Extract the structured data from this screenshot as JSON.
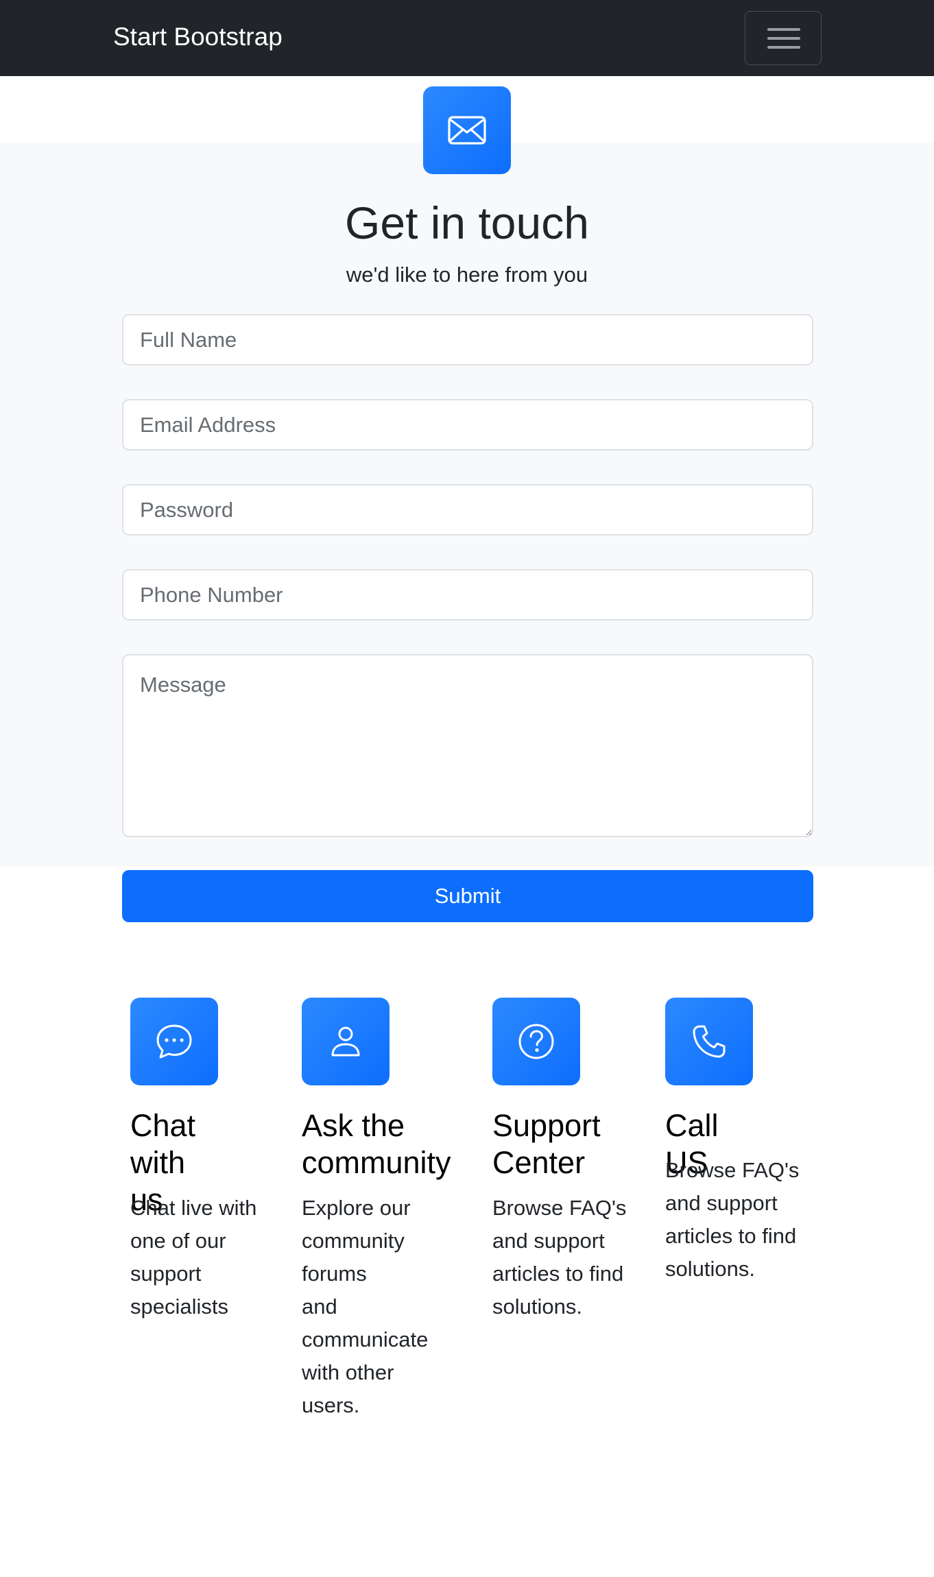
{
  "navbar": {
    "brand": "Start Bootstrap",
    "toggle_icon": "hamburger-icon"
  },
  "contact": {
    "icon": "envelope-icon",
    "title": "Get in touch",
    "subtitle": "we'd like to here from you",
    "fields": {
      "full_name": "Full Name",
      "email": "Email Address",
      "password": "Password",
      "phone": "Phone Number",
      "message": "Message"
    },
    "submit_label": "Submit"
  },
  "features": [
    {
      "icon": "chat-dots-icon",
      "title_lines": [
        "Chat with",
        "us"
      ],
      "desc_lines": [
        "Chat live with",
        "one of our",
        "support",
        "specialists"
      ]
    },
    {
      "icon": "person-icon",
      "title_lines": [
        "Ask the",
        "community"
      ],
      "desc_lines": [
        "Explore our",
        "community",
        "forums",
        "and",
        "communicate",
        "with other",
        "users."
      ]
    },
    {
      "icon": "question-circle-icon",
      "title_lines": [
        "Support",
        "Center"
      ],
      "desc_lines": [
        "Browse FAQ's",
        "and support",
        "articles to find",
        "solutions."
      ]
    },
    {
      "icon": "telephone-icon",
      "title_lines": [
        "Call US"
      ],
      "desc_lines": [
        "Browse FAQ's",
        "and support",
        "articles to find",
        "solutions."
      ]
    }
  ],
  "colors": {
    "navbar": "#212529",
    "primary": "#0d6efd",
    "section_bg": "#f8f9fa"
  }
}
